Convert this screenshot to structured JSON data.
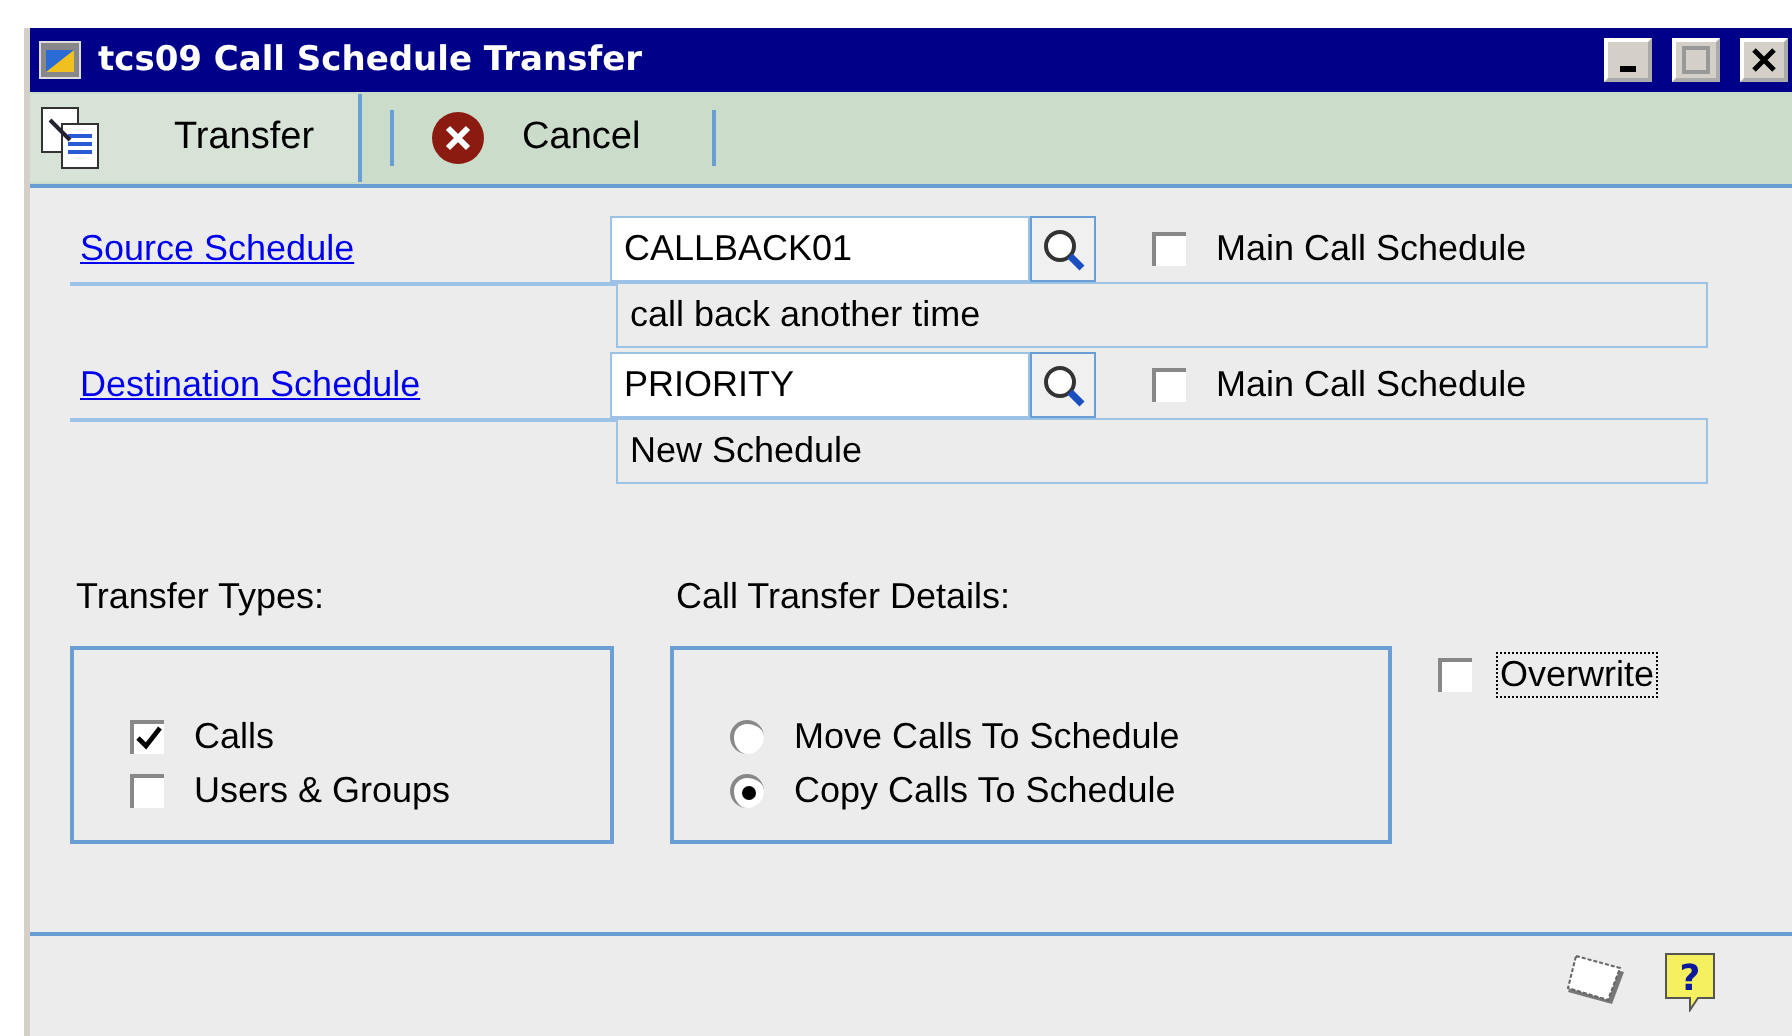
{
  "window": {
    "title": "tcs09 Call Schedule Transfer"
  },
  "toolbar": [
    {
      "label": "Transfer",
      "kind": "transfer"
    },
    {
      "label": "Cancel",
      "kind": "cancel"
    }
  ],
  "schedules": [
    {
      "label": "Source Schedule",
      "value": "CALLBACK01",
      "description": "call back another time",
      "main_label": "Main Call Schedule",
      "main_checked": false
    },
    {
      "label": "Destination Schedule",
      "value": "PRIORITY",
      "description": "New Schedule",
      "main_label": "Main Call Schedule",
      "main_checked": false
    }
  ],
  "transfer_types": {
    "label": "Transfer Types:",
    "options": [
      {
        "label": "Calls",
        "checked": true
      },
      {
        "label": "Users & Groups",
        "checked": false
      }
    ]
  },
  "details": {
    "label": "Call Transfer Details:",
    "options": [
      {
        "label": "Move Calls To Schedule",
        "selected": false
      },
      {
        "label": "Copy Calls To Schedule",
        "selected": true
      }
    ]
  },
  "overwrite": {
    "label": "Overwrite",
    "checked": false
  },
  "help": "?"
}
